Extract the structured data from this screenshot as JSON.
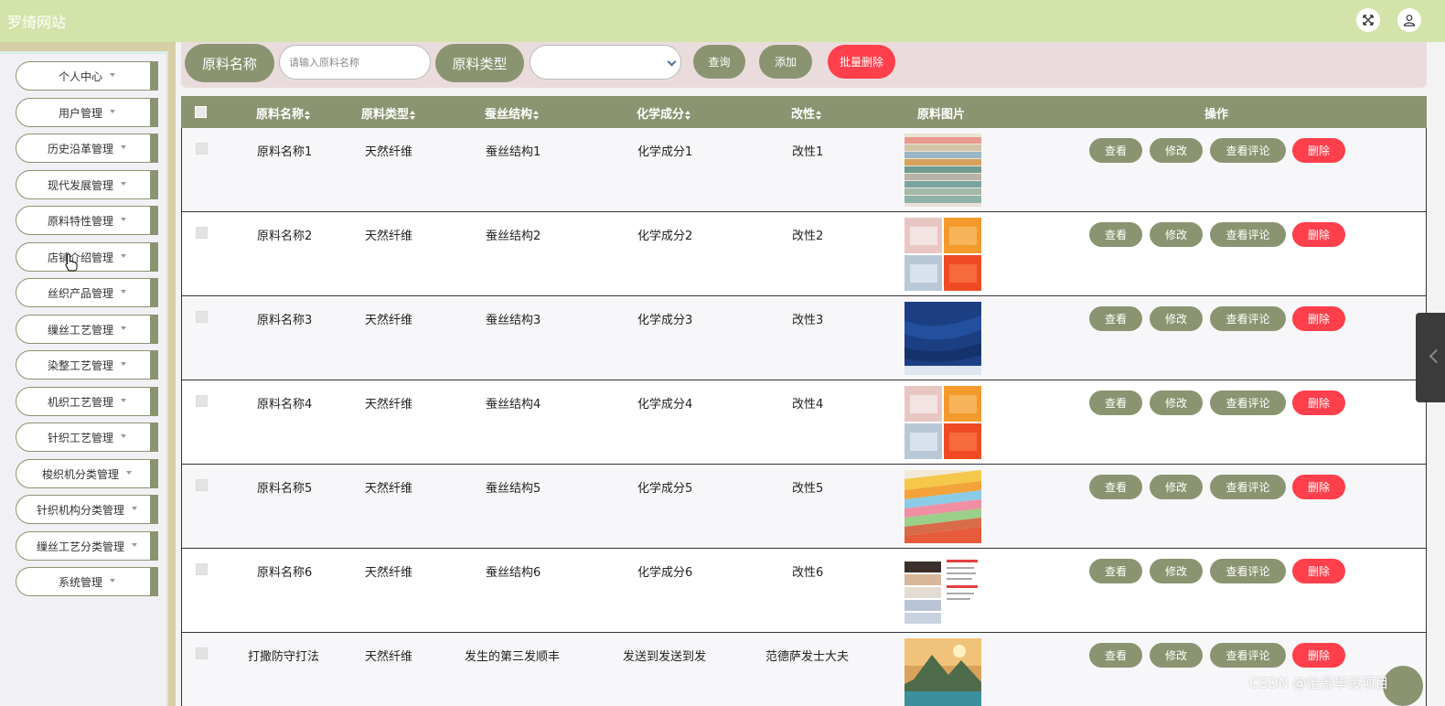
{
  "app": {
    "title": "罗绮网站"
  },
  "colors": {
    "olive": "#8b9470",
    "header_bg": "#d4e3a9",
    "danger": "#ff3f4b",
    "search_bg": "#eadcdc"
  },
  "sidebar": {
    "items": [
      {
        "label": "个人中心"
      },
      {
        "label": "用户管理"
      },
      {
        "label": "历史沿革管理"
      },
      {
        "label": "现代发展管理"
      },
      {
        "label": "原料特性管理"
      },
      {
        "label": "店铺介绍管理"
      },
      {
        "label": "丝织产品管理"
      },
      {
        "label": "缫丝工艺管理"
      },
      {
        "label": "染整工艺管理"
      },
      {
        "label": "机织工艺管理"
      },
      {
        "label": "针织工艺管理"
      },
      {
        "label": "梭织机分类管理"
      },
      {
        "label": "针织机构分类管理"
      },
      {
        "label": "缫丝工艺分类管理"
      },
      {
        "label": "系统管理"
      }
    ]
  },
  "search": {
    "name_label": "原料名称",
    "name_placeholder": "请输入原料名称",
    "type_label": "原料类型",
    "type_value": "",
    "query_button": "查询",
    "add_button": "添加",
    "batch_delete_button": "批量删除"
  },
  "table": {
    "headers": {
      "name": "原料名称",
      "type": "原料类型",
      "structure": "蚕丝结构",
      "chemistry": "化学成分",
      "modification": "改性",
      "image": "原料图片",
      "actions": "操作"
    },
    "action_labels": {
      "view": "查看",
      "edit": "修改",
      "reviews": "查看评论",
      "delete": "删除"
    },
    "rows": [
      {
        "name": "原料名称1",
        "type": "天然纤维",
        "structure": "蚕丝结构1",
        "chemistry": "化学成分1",
        "modification": "改性1",
        "image": "stacked-linen-fabric"
      },
      {
        "name": "原料名称2",
        "type": "天然纤维",
        "structure": "蚕丝结构2",
        "chemistry": "化学成分2",
        "modification": "改性2",
        "image": "tablecloth-grid"
      },
      {
        "name": "原料名称3",
        "type": "天然纤维",
        "structure": "蚕丝结构3",
        "chemistry": "化学成分3",
        "modification": "改性3",
        "image": "blue-fabric"
      },
      {
        "name": "原料名称4",
        "type": "天然纤维",
        "structure": "蚕丝结构4",
        "chemistry": "化学成分4",
        "modification": "改性4",
        "image": "tablecloth-grid"
      },
      {
        "name": "原料名称5",
        "type": "天然纤维",
        "structure": "蚕丝结构5",
        "chemistry": "化学成分5",
        "modification": "改性5",
        "image": "color-swatches"
      },
      {
        "name": "原料名称6",
        "type": "天然纤维",
        "structure": "蚕丝结构6",
        "chemistry": "化学成分6",
        "modification": "改性6",
        "image": "folded-fabric-card"
      },
      {
        "name": "打撒防守打法",
        "type": "天然纤维",
        "structure": "发生的第三发顺丰",
        "chemistry": "发送到发送到发",
        "modification": "范德萨发士大夫",
        "image": "landscape-photo"
      }
    ]
  },
  "watermark": "CSDN @怡景毕设项目"
}
